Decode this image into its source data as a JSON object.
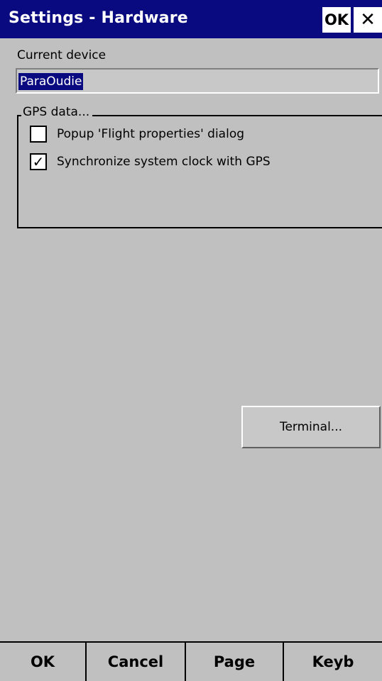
{
  "titlebar": {
    "title": "Settings - Hardware",
    "ok_label": "OK",
    "close_symbol": "✕"
  },
  "device": {
    "label": "Current device",
    "value": "ParaOudie"
  },
  "gps_group": {
    "legend": "GPS data...",
    "checkboxes": [
      {
        "label": "Popup 'Flight properties' dialog",
        "checked": false
      },
      {
        "label": "Synchronize system clock with GPS",
        "checked": true
      }
    ]
  },
  "terminal_button": "Terminal...",
  "bottom_bar": {
    "ok": "OK",
    "cancel": "Cancel",
    "page": "Page",
    "keyb": "Keyb"
  }
}
